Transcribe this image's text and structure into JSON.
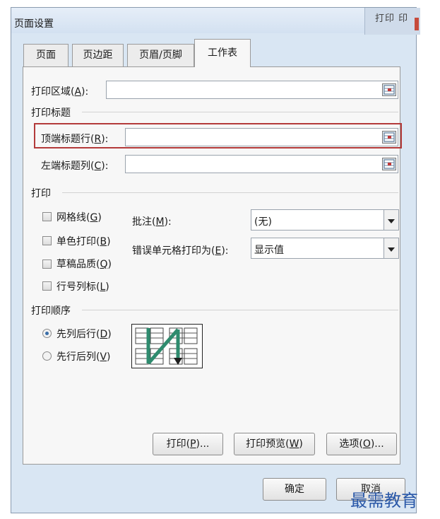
{
  "dialog": {
    "title": "页面设置",
    "background_window_text": "打印 印"
  },
  "tabs": [
    {
      "label": "页面",
      "active": false
    },
    {
      "label": "页边距",
      "active": false
    },
    {
      "label": "页眉/页脚",
      "active": false
    },
    {
      "label": "工作表",
      "active": true
    }
  ],
  "print_area": {
    "label": "打印区域(A):",
    "accel": "A",
    "value": ""
  },
  "print_titles": {
    "section_label": "打印标题",
    "top_rows": {
      "label": "顶端标题行(R):",
      "accel": "R",
      "value": ""
    },
    "left_columns": {
      "label": "左端标题列(C):",
      "accel": "C",
      "value": ""
    }
  },
  "print": {
    "section_label": "打印",
    "gridlines": {
      "label": "网格线(G)",
      "checked": false
    },
    "black_white": {
      "label": "单色打印(B)",
      "checked": false
    },
    "draft_quality": {
      "label": "草稿品质(Q)",
      "checked": false
    },
    "row_col_headings": {
      "label": "行号列标(L)",
      "checked": false
    },
    "comments": {
      "label": "批注(M):",
      "value": "(无)"
    },
    "cell_errors": {
      "label": "错误单元格打印为(E):",
      "value": "显示值"
    }
  },
  "page_order": {
    "section_label": "打印顺序",
    "down_then_over": {
      "label": "先列后行(D)",
      "selected": true
    },
    "over_then_down": {
      "label": "先行后列(V)",
      "selected": false
    }
  },
  "buttons": {
    "print": "打印(P)...",
    "print_preview": "打印预览(W)",
    "options": "选项(O)...",
    "ok": "确定",
    "cancel": "取消"
  },
  "watermark": "最需教育",
  "colors": {
    "highlight_border": "#b33a3a",
    "radio_dot": "#3a6ea8",
    "order_arrow": "#2e8b6e"
  }
}
